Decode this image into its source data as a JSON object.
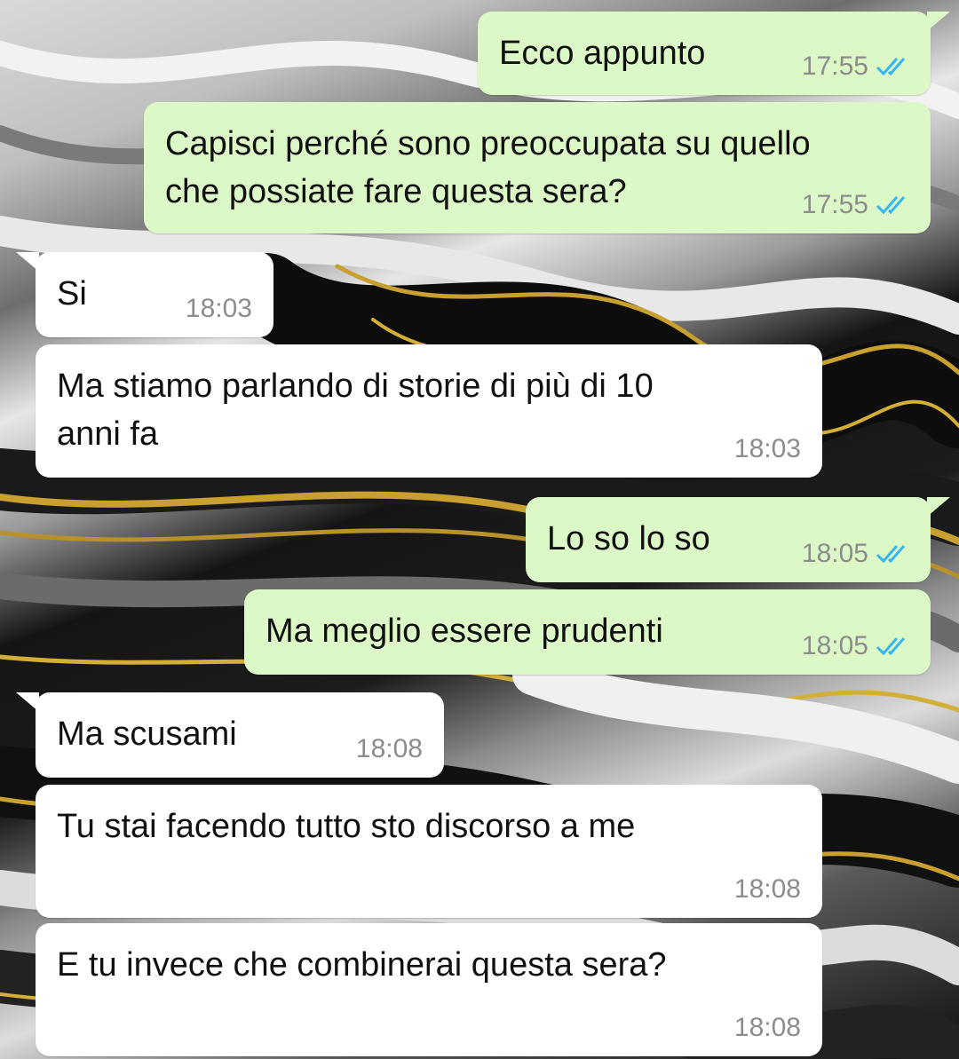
{
  "conversation": {
    "messages": [
      {
        "direction": "outgoing",
        "text": "Ecco appunto",
        "time": "17:55",
        "status": "read"
      },
      {
        "direction": "outgoing",
        "text": "Capisci perché sono preoccupata su quello\nche possiate fare questa sera?",
        "time": "17:55",
        "status": "read"
      },
      {
        "direction": "incoming",
        "text": "Si",
        "time": "18:03"
      },
      {
        "direction": "incoming",
        "text": "Ma stiamo parlando di storie di più di 10\nanni fa",
        "time": "18:03"
      },
      {
        "direction": "outgoing",
        "text": "Lo so lo so",
        "time": "18:05",
        "status": "read"
      },
      {
        "direction": "outgoing",
        "text": "Ma meglio essere prudenti",
        "time": "18:05",
        "status": "read"
      },
      {
        "direction": "incoming",
        "text": "Ma scusami",
        "time": "18:08"
      },
      {
        "direction": "incoming",
        "text": "Tu stai facendo tutto sto discorso a me",
        "time": "18:08"
      },
      {
        "direction": "incoming",
        "text": "E tu invece che combinerai questa sera?",
        "time": "18:08"
      }
    ]
  },
  "colors": {
    "outgoing_bubble": "#dcf8c6",
    "incoming_bubble": "#ffffff",
    "read_ticks": "#34b7f1",
    "timestamp": "#8c8c8c",
    "wallpaper_gold": "#c9a030"
  },
  "icons": {
    "read_receipt": "double-check-icon"
  }
}
